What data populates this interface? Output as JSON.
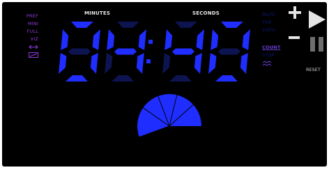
{
  "left_menu": {
    "items": [
      {
        "label": "PREF"
      },
      {
        "label": "MINI"
      },
      {
        "label": "FULL"
      },
      {
        "label": "VIZ"
      }
    ],
    "icons": [
      "swap-arrows-icon",
      "screen-icon"
    ]
  },
  "display": {
    "minutes_label": "MINUTES",
    "seconds_label": "SECONDS",
    "minutes": "04",
    "seconds": "40",
    "separator": ":"
  },
  "right_menu": {
    "sound_options": [
      {
        "label": "MUTE"
      },
      {
        "label": "TOP"
      },
      {
        "label": "100%"
      }
    ],
    "mode_options": [
      {
        "label": "COUNT",
        "selected": true
      },
      {
        "label": "STOP",
        "selected": false
      }
    ],
    "mode_icon": "link-arrows-icon"
  },
  "controls": {
    "plus_icon": "plus-icon",
    "minus_icon": "minus-icon",
    "play_icon": "play-icon",
    "pause_icon": "pause-icon",
    "reset_label": "RESET"
  },
  "timer_dial": {
    "icon": "pie-sector-icon",
    "fraction_elapsed": 0.3
  },
  "colors": {
    "background": "#000000",
    "lit_segment": "#1f2eff",
    "dim_segment": "#0d1450",
    "menu_purple": "#8e3bdc",
    "menu_blue_dim": "#0b1a7a"
  }
}
